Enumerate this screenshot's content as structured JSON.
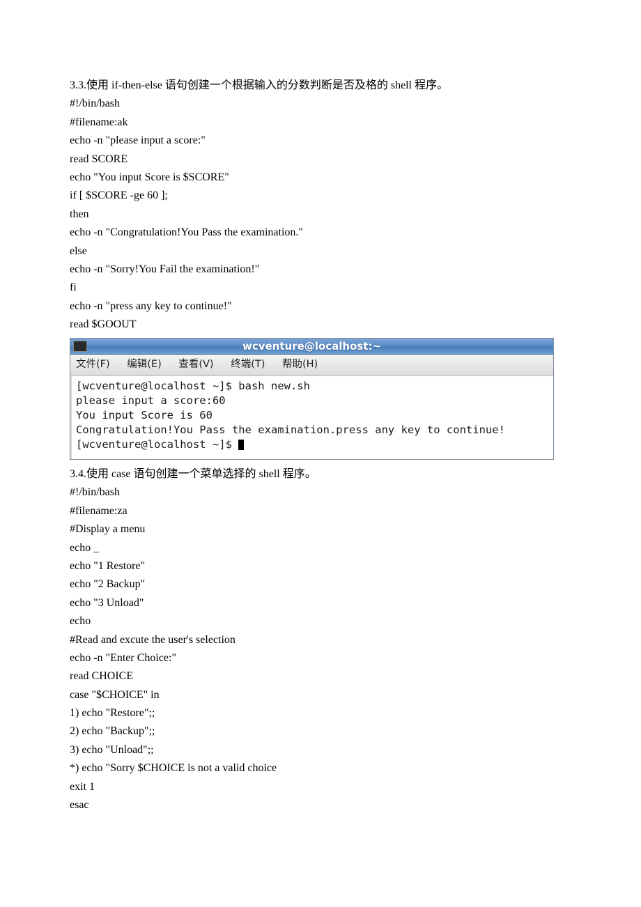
{
  "section33": {
    "title": "3.3.使用 if-then-else 语句创建一个根据输入的分数判断是否及格的 shell 程序。",
    "lines": [
      "#!/bin/bash",
      "#filename:ak",
      "echo -n \"please input a score:\"",
      "read SCORE",
      "echo \"You input Score is $SCORE\"",
      "if [ $SCORE -ge 60 ];",
      "then",
      "echo -n \"Congratulation!You Pass the examination.\"",
      "else",
      "echo -n \"Sorry!You Fail the examination!\"",
      "fi",
      "echo -n \"press any key to continue!\"",
      "read $GOOUT"
    ]
  },
  "terminal": {
    "title": "wcventure@localhost:~",
    "menu": {
      "file": "文件(F)",
      "edit": "编辑(E)",
      "view": "查看(V)",
      "terminal": "终端(T)",
      "help": "帮助(H)"
    },
    "output": [
      "[wcventure@localhost ~]$ bash new.sh",
      "please input a score:60",
      "You input Score is 60",
      "Congratulation!You Pass the examination.press any key to continue!",
      "[wcventure@localhost ~]$ "
    ]
  },
  "section34": {
    "title": "3.4.使用 case 语句创建一个菜单选择的 shell 程序。",
    "lines": [
      "#!/bin/bash",
      "#filename:za",
      "#Display a menu",
      "echo _",
      "echo \"1 Restore\"",
      "echo \"2 Backup\"",
      "echo \"3 Unload\"",
      "echo",
      "#Read and excute the user's selection",
      "echo -n \"Enter Choice:\"",
      "read CHOICE",
      "case \"$CHOICE\" in",
      "1) echo \"Restore\";;",
      "2) echo \"Backup\";;",
      "3) echo \"Unload\";;",
      "*) echo \"Sorry $CHOICE is not a valid choice",
      "exit 1",
      "esac"
    ]
  }
}
